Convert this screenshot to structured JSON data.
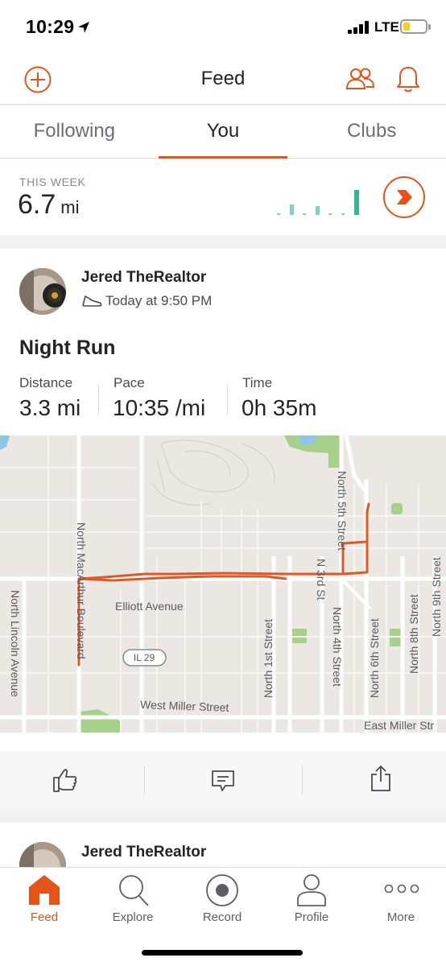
{
  "status_bar": {
    "time": "10:29",
    "carrier": "LTE"
  },
  "header": {
    "title": "Feed"
  },
  "tabs": [
    {
      "label": "Following",
      "active": false
    },
    {
      "label": "You",
      "active": true
    },
    {
      "label": "Clubs",
      "active": false
    }
  ],
  "this_week": {
    "label": "THIS WEEK",
    "value": "6.7",
    "unit": "mi"
  },
  "activity": {
    "athlete": "Jered TheRealtor",
    "timestamp": "Today at 9:50 PM",
    "title": "Night Run",
    "stats": [
      {
        "label": "Distance",
        "value": "3.3 mi"
      },
      {
        "label": "Pace",
        "value": "10:35 /mi"
      },
      {
        "label": "Time",
        "value": "0h 35m"
      }
    ],
    "map": {
      "labels": {
        "north_5th": "North 5th Street",
        "n_3rd": "N 3rd St",
        "north_4th": "North 4th Street",
        "north_1st": "North 1st Street",
        "north_6th": "North 6th Street",
        "north_8th": "North 8th Street",
        "north_9th": "North 9th Street",
        "macarthur": "North MacArthur Boulevard",
        "lincoln": "North Lincoln Avenue",
        "elliott": "Elliott Avenue",
        "il29": "IL 29",
        "west_miller": "West Miller Street",
        "east_miller": "East Miller Str"
      }
    }
  },
  "next_activity": {
    "athlete": "Jered TheRealtor"
  },
  "bottom_nav": [
    {
      "label": "Feed",
      "active": true
    },
    {
      "label": "Explore",
      "active": false
    },
    {
      "label": "Record",
      "active": false
    },
    {
      "label": "Profile",
      "active": false
    },
    {
      "label": "More",
      "active": false
    }
  ],
  "colors": {
    "accent": "#e5531a",
    "week_bars": "#7fd3b8",
    "week_bar_current": "#34b78f",
    "route": "#e0572a",
    "park": "#a7d18b"
  }
}
